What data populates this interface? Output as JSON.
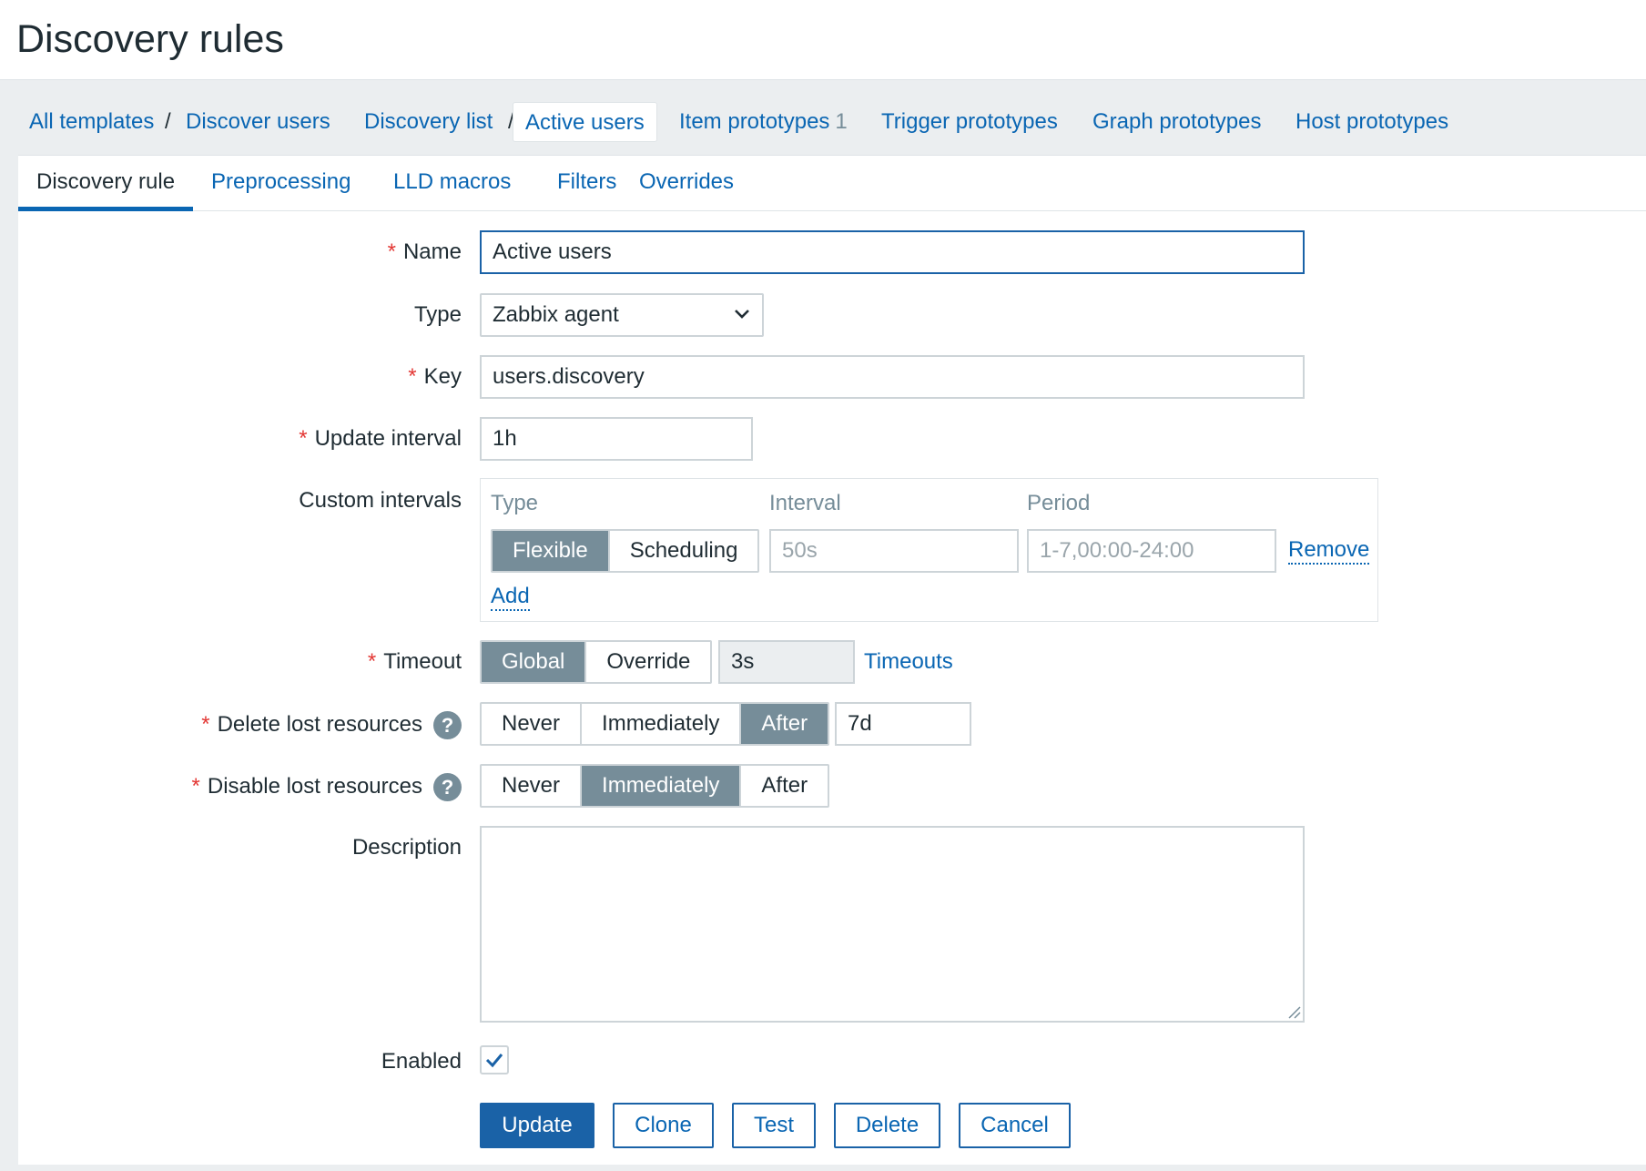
{
  "page": {
    "title": "Discovery rules"
  },
  "breadcrumb": {
    "all_templates": "All templates",
    "separator": "/",
    "template": "Discover users",
    "discovery_list": "Discovery list",
    "current": "Active users",
    "item_prototypes": "Item prototypes",
    "item_prototypes_count": "1",
    "trigger_prototypes": "Trigger prototypes",
    "graph_prototypes": "Graph prototypes",
    "host_prototypes": "Host prototypes"
  },
  "tabs": [
    {
      "label": "Discovery rule",
      "active": true
    },
    {
      "label": "Preprocessing"
    },
    {
      "label": "LLD macros"
    },
    {
      "label": "Filters"
    },
    {
      "label": "Overrides"
    }
  ],
  "form": {
    "required_mark": "*",
    "name": {
      "label": "Name",
      "value": "Active users"
    },
    "type": {
      "label": "Type",
      "value": "Zabbix agent"
    },
    "key": {
      "label": "Key",
      "value": "users.discovery"
    },
    "update_interval": {
      "label": "Update interval",
      "value": "1h"
    },
    "custom_intervals": {
      "label": "Custom intervals",
      "col_type": "Type",
      "col_interval": "Interval",
      "col_period": "Period",
      "type_options": [
        "Flexible",
        "Scheduling"
      ],
      "type_selected": "Flexible",
      "interval_placeholder": "50s",
      "period_placeholder": "1-7,00:00-24:00",
      "remove_label": "Remove",
      "add_label": "Add"
    },
    "timeout": {
      "label": "Timeout",
      "options": [
        "Global",
        "Override"
      ],
      "selected": "Global",
      "value": "3s",
      "link": "Timeouts"
    },
    "delete_lost": {
      "label": "Delete lost resources",
      "options": [
        "Never",
        "Immediately",
        "After"
      ],
      "selected": "After",
      "value": "7d"
    },
    "disable_lost": {
      "label": "Disable lost resources",
      "options": [
        "Never",
        "Immediately",
        "After"
      ],
      "selected": "Immediately"
    },
    "description": {
      "label": "Description",
      "value": ""
    },
    "enabled": {
      "label": "Enabled",
      "checked": true
    }
  },
  "buttons": {
    "update": "Update",
    "clone": "Clone",
    "test": "Test",
    "delete": "Delete",
    "cancel": "Cancel"
  },
  "icons": {
    "help": "question-mark-circle-icon",
    "select": "chevron-down-icon",
    "check": "checkmark-icon",
    "resize": "resize-grip-icon"
  },
  "colors": {
    "link": "#0a66b3",
    "primary_button": "#1a62a7",
    "segment_active": "#768d99",
    "required": "#e33734",
    "background": "#ebeef0"
  }
}
